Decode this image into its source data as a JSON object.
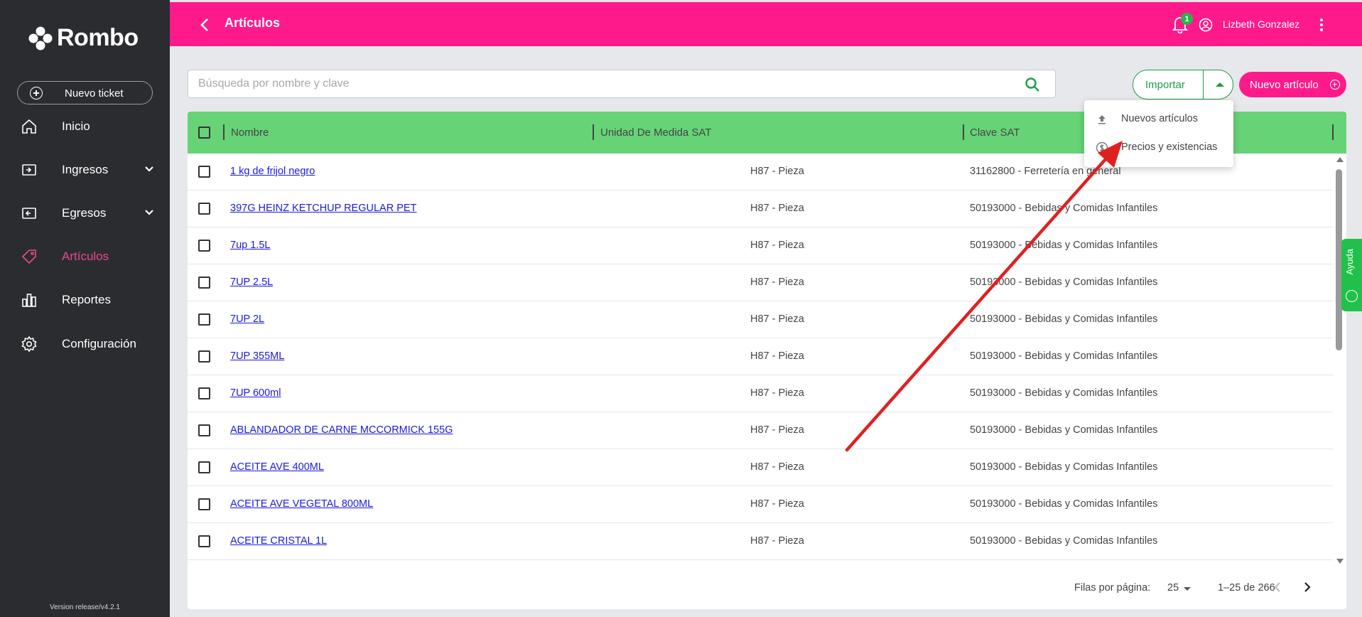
{
  "sidebar": {
    "logo": "Rombo",
    "new_ticket": "Nuevo ticket",
    "items": [
      {
        "label": "Inicio",
        "icon": "home-icon"
      },
      {
        "label": "Ingresos",
        "icon": "income-icon"
      },
      {
        "label": "Egresos",
        "icon": "expense-icon"
      },
      {
        "label": "Artículos",
        "icon": "tag-icon",
        "active": true
      },
      {
        "label": "Reportes",
        "icon": "reports-icon"
      },
      {
        "label": "Configuración",
        "icon": "gear-icon"
      }
    ],
    "version": "Version release/v4.2.1"
  },
  "header": {
    "title": "Artículos",
    "notification_count": "1",
    "user_name": "Lizbeth Gonzalez"
  },
  "toolbar": {
    "search_placeholder": "Búsqueda por nombre y clave",
    "import_label": "Importar",
    "new_article_label": "Nuevo artículo"
  },
  "import_menu": {
    "items": [
      {
        "label": "Nuevos artículos",
        "icon": "upload-icon"
      },
      {
        "label": "Precios y existencias",
        "icon": "dollar-circle-icon"
      }
    ]
  },
  "table": {
    "columns": [
      "Nombre",
      "Unidad De Medida SAT",
      "Clave SAT"
    ],
    "rows": [
      {
        "name": "1 kg de frijol negro",
        "unit": "H87 - Pieza",
        "clave": "31162800 - Ferretería en general"
      },
      {
        "name": "397G HEINZ KETCHUP REGULAR PET",
        "unit": "H87 - Pieza",
        "clave": "50193000 - Bebidas y Comidas Infantiles"
      },
      {
        "name": "7up 1.5L",
        "unit": "H87 - Pieza",
        "clave": "50193000 - Bebidas y Comidas Infantiles"
      },
      {
        "name": "7UP 2.5L",
        "unit": "H87 - Pieza",
        "clave": "50193000 - Bebidas y Comidas Infantiles"
      },
      {
        "name": "7UP 2L",
        "unit": "H87 - Pieza",
        "clave": "50193000 - Bebidas y Comidas Infantiles"
      },
      {
        "name": "7UP 355ML",
        "unit": "H87 - Pieza",
        "clave": "50193000 - Bebidas y Comidas Infantiles"
      },
      {
        "name": "7UP 600ml",
        "unit": "H87 - Pieza",
        "clave": "50193000 - Bebidas y Comidas Infantiles"
      },
      {
        "name": "ABLANDADOR DE CARNE MCCORMICK 155G",
        "unit": "H87 - Pieza",
        "clave": "50193000 - Bebidas y Comidas Infantiles"
      },
      {
        "name": "ACEITE AVE 400ML",
        "unit": "H87 - Pieza",
        "clave": "50193000 - Bebidas y Comidas Infantiles"
      },
      {
        "name": "ACEITE AVE VEGETAL 800ML",
        "unit": "H87 - Pieza",
        "clave": "50193000 - Bebidas y Comidas Infantiles"
      },
      {
        "name": "ACEITE CRISTAL 1L",
        "unit": "H87 - Pieza",
        "clave": "50193000 - Bebidas y Comidas Infantiles"
      }
    ],
    "rows_per_page_label": "Filas por página:",
    "rows_per_page": "25",
    "range": "1–25 de 266"
  },
  "help": {
    "label": "Ayuda"
  },
  "colors": {
    "brand": "#ff1a8c",
    "header_row": "#67d377",
    "accent_green": "#1d9e43",
    "sidebar": "#2b2c30",
    "annotation": "#e02020"
  }
}
